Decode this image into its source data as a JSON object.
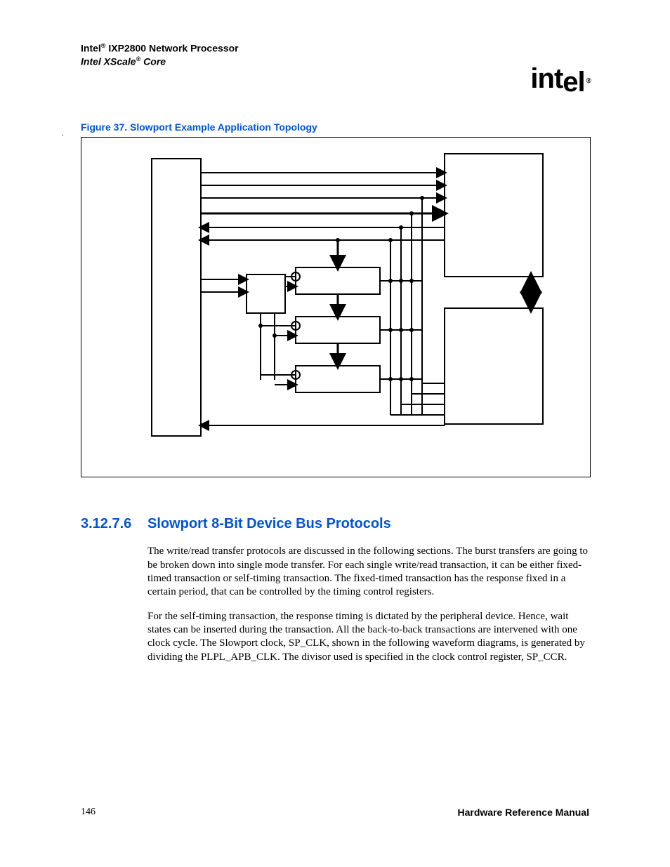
{
  "header": {
    "line1_prefix": "Intel",
    "line1_suffix": " IXP2800 Network Processor",
    "line2_prefix": "Intel XScale",
    "line2_suffix": " Core",
    "reg_symbol": "®"
  },
  "logo": {
    "text": "int",
    "text2": "el",
    "reg": "®"
  },
  "figure": {
    "caption": "Figure 37. Slowport Example Application Topology"
  },
  "dot": ".",
  "section": {
    "number": "3.12.7.6",
    "title": "Slowport 8-Bit Device Bus Protocols"
  },
  "paragraphs": {
    "p1": "The write/read transfer protocols are discussed in the following sections. The burst transfers are going to be broken down into single mode transfer. For each single write/read transaction, it can be either fixed-timed transaction or self-timing transaction. The fixed-timed transaction has the response fixed in a certain period, that can be controlled by the timing control registers.",
    "p2": "For the self-timing transaction, the response timing is dictated by the peripheral device. Hence, wait states can be inserted during the transaction. All the back-to-back transactions are intervened with one clock cycle. The Slowport clock, SP_CLK, shown in the following waveform diagrams, is generated by dividing the PLPL_APB_CLK. The divisor used is specified in the clock control register, SP_CCR."
  },
  "footer": {
    "page": "146",
    "title": "Hardware Reference Manual"
  }
}
